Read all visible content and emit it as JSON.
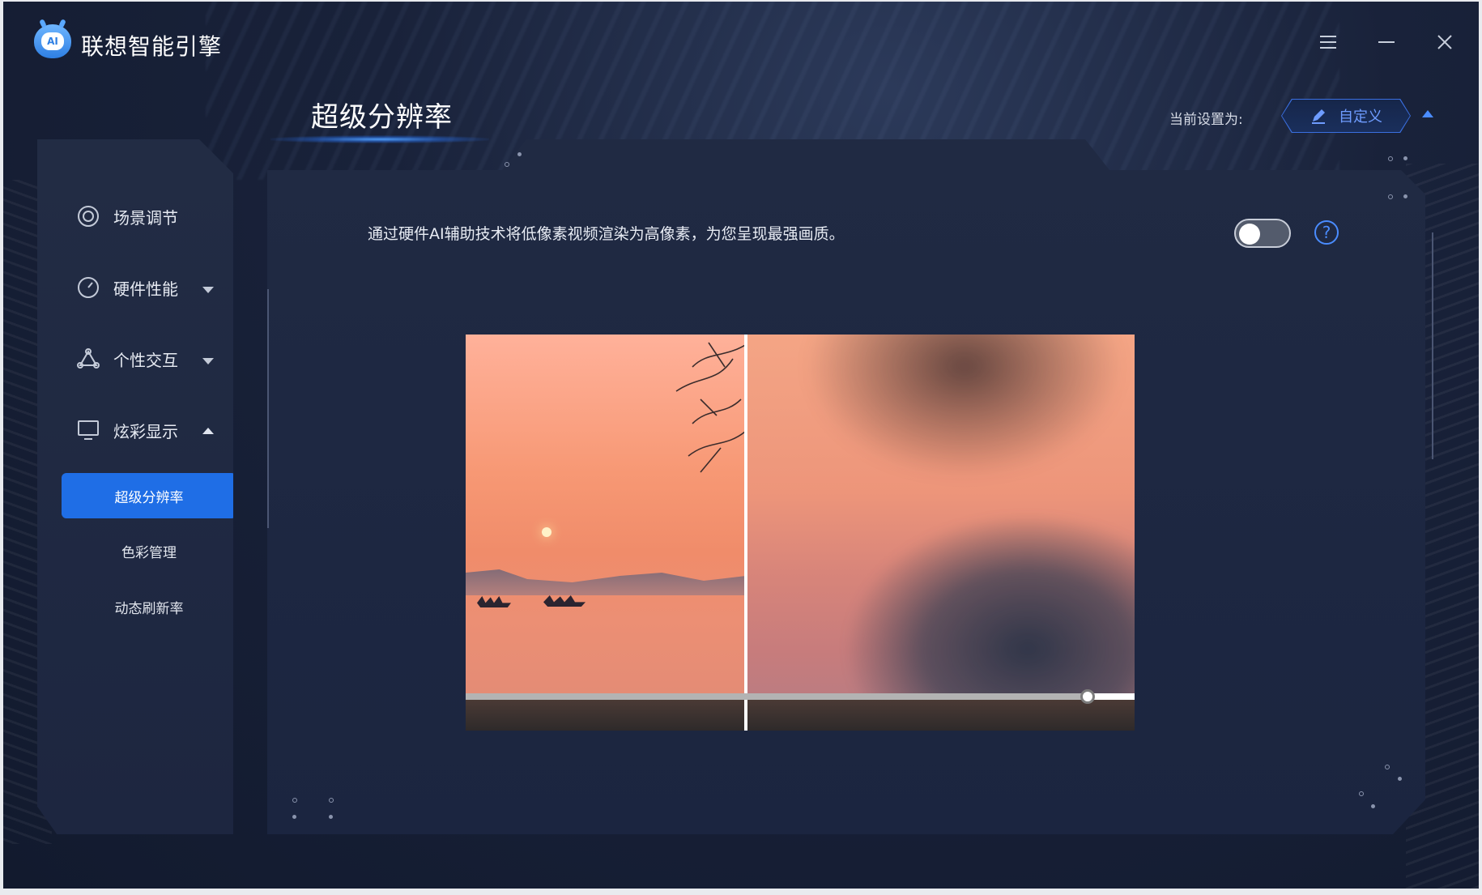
{
  "app": {
    "title": "联想智能引擎",
    "logo_text": "AI"
  },
  "window_controls": [
    "menu-icon",
    "minimize-icon",
    "close-icon"
  ],
  "page": {
    "title": "超级分辨率",
    "current_setting_label": "当前设置为:",
    "preset_label": "自定义"
  },
  "sidebar": {
    "items": [
      {
        "label": "场景调节",
        "icon": "target-icon",
        "expanded": null
      },
      {
        "label": "硬件性能",
        "icon": "gauge-icon",
        "expanded": false
      },
      {
        "label": "个性交互",
        "icon": "triangle-nodes-icon",
        "expanded": false
      },
      {
        "label": "炫彩显示",
        "icon": "monitor-icon",
        "expanded": true
      }
    ],
    "sub_items": [
      {
        "label": "超级分辨率",
        "active": true
      },
      {
        "label": "色彩管理",
        "active": false
      },
      {
        "label": "动态刷新率",
        "active": false
      }
    ]
  },
  "main": {
    "description": "通过硬件AI辅助技术将低像素视频渲染为高像素，为您呈现最强画质。",
    "toggle_on": false,
    "help_symbol": "?",
    "compare_slider_value": 0.93
  },
  "colors": {
    "accent": "#1f6ee6",
    "accent_text": "#4a8cff",
    "panel": "#202a43",
    "background": "#19223a"
  }
}
